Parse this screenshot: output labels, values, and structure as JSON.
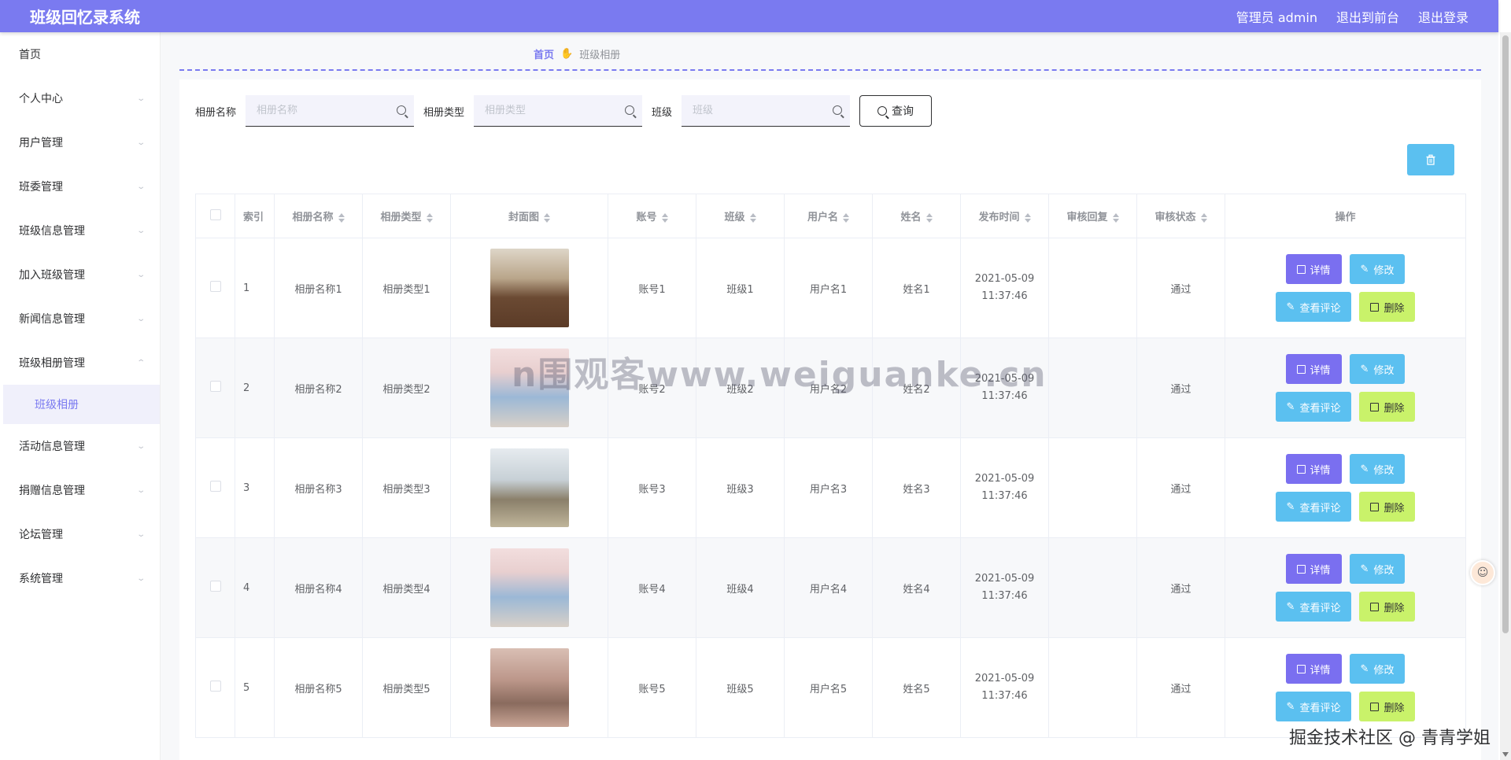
{
  "header": {
    "brand": "班级回忆录系统",
    "links": [
      "管理员 admin",
      "退出到前台",
      "退出登录"
    ]
  },
  "sidebar": {
    "items": [
      {
        "label": "首页",
        "expandable": false
      },
      {
        "label": "个人中心",
        "expandable": true
      },
      {
        "label": "用户管理",
        "expandable": true
      },
      {
        "label": "班委管理",
        "expandable": true
      },
      {
        "label": "班级信息管理",
        "expandable": true
      },
      {
        "label": "加入班级管理",
        "expandable": true
      },
      {
        "label": "新闻信息管理",
        "expandable": true
      },
      {
        "label": "班级相册管理",
        "expandable": true,
        "open": true
      },
      {
        "label": "活动信息管理",
        "expandable": true
      },
      {
        "label": "捐赠信息管理",
        "expandable": true
      },
      {
        "label": "论坛管理",
        "expandable": true
      },
      {
        "label": "系统管理",
        "expandable": true
      }
    ],
    "sub_item": "班级相册"
  },
  "breadcrumb": {
    "home": "首页",
    "current": "班级相册"
  },
  "filters": {
    "name_label": "相册名称",
    "name_placeholder": "相册名称",
    "type_label": "相册类型",
    "type_placeholder": "相册类型",
    "class_label": "班级",
    "class_placeholder": "班级",
    "query_label": "查询"
  },
  "table": {
    "columns": [
      "索引",
      "相册名称",
      "相册类型",
      "封面图",
      "账号",
      "班级",
      "用户名",
      "姓名",
      "发布时间",
      "审核回复",
      "审核状态",
      "操作"
    ],
    "rows": [
      {
        "index": "1",
        "name": "相册名称1",
        "type": "相册类型1",
        "account": "账号1",
        "class": "班级1",
        "username": "用户名1",
        "realname": "姓名1",
        "time": "2021-05-09 11:37:46",
        "reply": "",
        "status": "通过"
      },
      {
        "index": "2",
        "name": "相册名称2",
        "type": "相册类型2",
        "account": "账号2",
        "class": "班级2",
        "username": "用户名2",
        "realname": "姓名2",
        "time": "2021-05-09 11:37:46",
        "reply": "",
        "status": "通过"
      },
      {
        "index": "3",
        "name": "相册名称3",
        "type": "相册类型3",
        "account": "账号3",
        "class": "班级3",
        "username": "用户名3",
        "realname": "姓名3",
        "time": "2021-05-09 11:37:46",
        "reply": "",
        "status": "通过"
      },
      {
        "index": "4",
        "name": "相册名称4",
        "type": "相册类型4",
        "account": "账号4",
        "class": "班级4",
        "username": "用户名4",
        "realname": "姓名4",
        "time": "2021-05-09 11:37:46",
        "reply": "",
        "status": "通过"
      },
      {
        "index": "5",
        "name": "相册名称5",
        "type": "相册类型5",
        "account": "账号5",
        "class": "班级5",
        "username": "用户名5",
        "realname": "姓名5",
        "time": "2021-05-09 11:37:46",
        "reply": "",
        "status": "通过"
      }
    ],
    "actions": {
      "detail": "详情",
      "edit": "修改",
      "comments": "查看评论",
      "delete": "删除"
    }
  },
  "overlay": {
    "watermark": "n围观客www.weiguanke.cn",
    "credit": "掘金技术社区 @ 青青学姐"
  },
  "colors": {
    "primary": "#7a7af0",
    "info": "#5bc0f0",
    "lime": "#c9f26a"
  }
}
